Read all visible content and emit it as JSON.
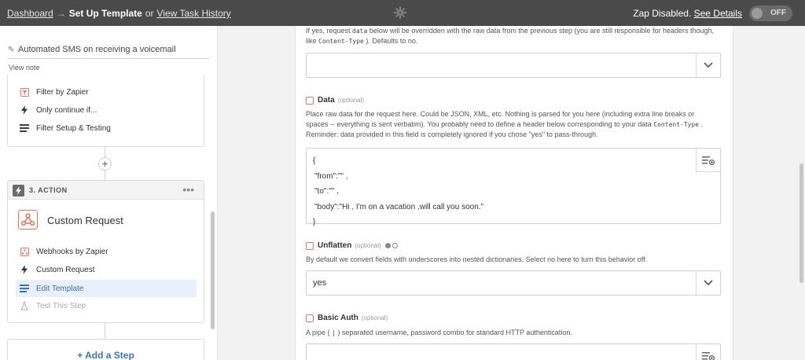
{
  "topbar": {
    "dashboard": "Dashboard",
    "arrow": "→",
    "current": "Set Up Template",
    "or": "or",
    "history": "View Task History",
    "status": "Zap Disabled.",
    "see_details": "See Details",
    "toggle": "OFF"
  },
  "sidebar": {
    "zap_name": "Automated SMS on receiving a voicemail",
    "view_note": "View note",
    "filter_steps": [
      {
        "label": "Filter by Zapier",
        "icon": "filter-icon"
      },
      {
        "label": "Only continue if...",
        "icon": "bolt-icon"
      },
      {
        "label": "Filter Setup & Testing",
        "icon": "list-icon"
      }
    ],
    "plus": "+",
    "action": {
      "title": "3. ACTION",
      "menu": "•••",
      "app_title": "Custom Request",
      "steps": [
        {
          "label": "Webhooks by Zapier",
          "icon": "webhook-icon"
        },
        {
          "label": "Custom Request",
          "icon": "bolt-icon"
        },
        {
          "label": "Edit Template",
          "icon": "list-icon"
        },
        {
          "label": "Test This Step",
          "icon": "flask-icon"
        }
      ]
    },
    "add_step": "+ Add a Step"
  },
  "main": {
    "intro_pre": "If yes, request",
    "intro_code1": "data",
    "intro_mid": "below will be overridden with the raw data from the previous step (you are still responsible for headers though, like",
    "intro_code2": "Content-Type",
    "intro_post": "). Defaults to no.",
    "data_label": "Data",
    "data_optional": "(optional)",
    "data_desc_pre": "Place raw data for the request here. Could be JSON, XML, etc. Nothing is parsed for you here (including extra line breaks or spaces -- everything is sent verbatim). You probably need to define a header below corresponding to your data",
    "data_desc_code": "Content-Type",
    "data_desc_post": ". Reminder: data provided in this field is completely ignored if you chose \"yes\" to pass-through.",
    "data_lines": [
      "{",
      "\"from\":\"\" ,",
      "\"to\":\"\" ,",
      "\"body\":\"Hi , I'm on a vacation ,will call you soon.\"",
      "}"
    ],
    "unflatten_label": "Unflatten",
    "unflatten_optional": "(optional)",
    "unflatten_desc": "By default we convert fields with underscores into nested dictionaries. Select no here to turn this behavior off.",
    "unflatten_value": "yes",
    "basic_auth_label": "Basic Auth",
    "basic_auth_optional": "(optional)",
    "basic_auth_desc_pre": "A pipe (",
    "basic_auth_desc_code": "|",
    "basic_auth_desc_post": ") separated username, password combo for standard HTTP authentication."
  },
  "colors": {
    "topbar": "#4a4a4a",
    "zapier_orange": "#e6755a",
    "link_blue": "#3b73c4",
    "selected_bg": "#e8f1fb"
  }
}
